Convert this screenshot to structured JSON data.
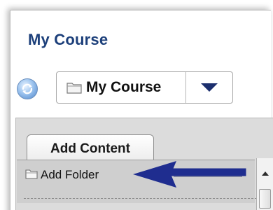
{
  "header": {
    "title": "My Course"
  },
  "course_selector": {
    "refresh_icon": "refresh-icon",
    "folder_icon": "folder-icon",
    "value": "My Course",
    "arrow_icon": "triangle-down-icon"
  },
  "toolbar": {
    "add_content_label": "Add Content"
  },
  "menu": {
    "items": [
      {
        "label": "Add Folder",
        "icon": "folder-icon"
      }
    ]
  },
  "annotation": {
    "arrow_color": "#1f2d8f"
  },
  "colors": {
    "title": "#1c3f7a",
    "panel": "#dcdcdc",
    "menu": "#cfcfcf"
  }
}
